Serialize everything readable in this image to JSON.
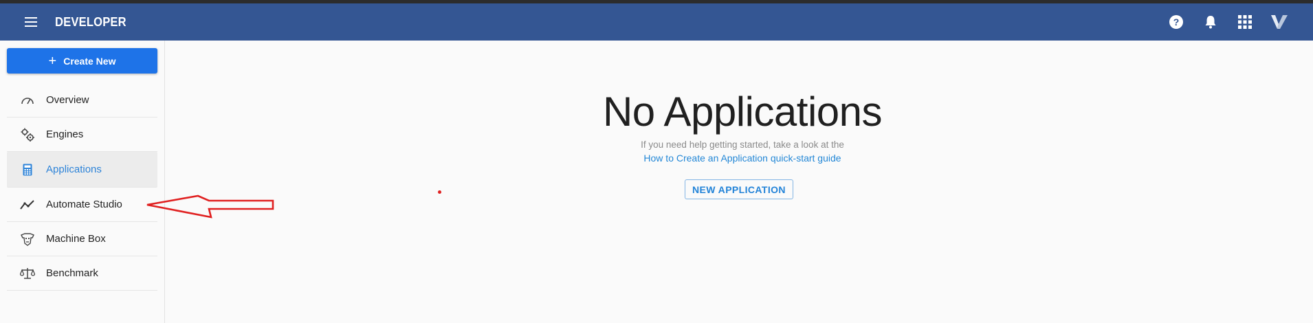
{
  "header": {
    "title": "DEVELOPER",
    "icons": [
      "menu-icon",
      "help-icon",
      "bell-icon",
      "apps-grid-icon",
      "veritone-logo-icon"
    ],
    "help_glyph": "?",
    "bg_color": "#345693"
  },
  "sidebar": {
    "create_label": "Create New",
    "create_glyph": "+",
    "items": [
      {
        "label": "Overview",
        "icon": "gauge-icon"
      },
      {
        "label": "Engines",
        "icon": "gears-icon"
      },
      {
        "label": "Applications",
        "icon": "calculator-icon",
        "active": true
      },
      {
        "label": "Automate Studio",
        "icon": "trend-line-icon"
      },
      {
        "label": "Machine Box",
        "icon": "machine-box-icon"
      },
      {
        "label": "Benchmark",
        "icon": "balance-scale-icon"
      }
    ]
  },
  "main": {
    "title": "No Applications",
    "help_text": "If you need help getting started, take a look at the",
    "help_link": "How to Create an Application quick-start guide",
    "new_button": "NEW APPLICATION"
  },
  "colors": {
    "accent": "#1e73e8",
    "link": "#2387d6",
    "annotation": "#e02020"
  }
}
